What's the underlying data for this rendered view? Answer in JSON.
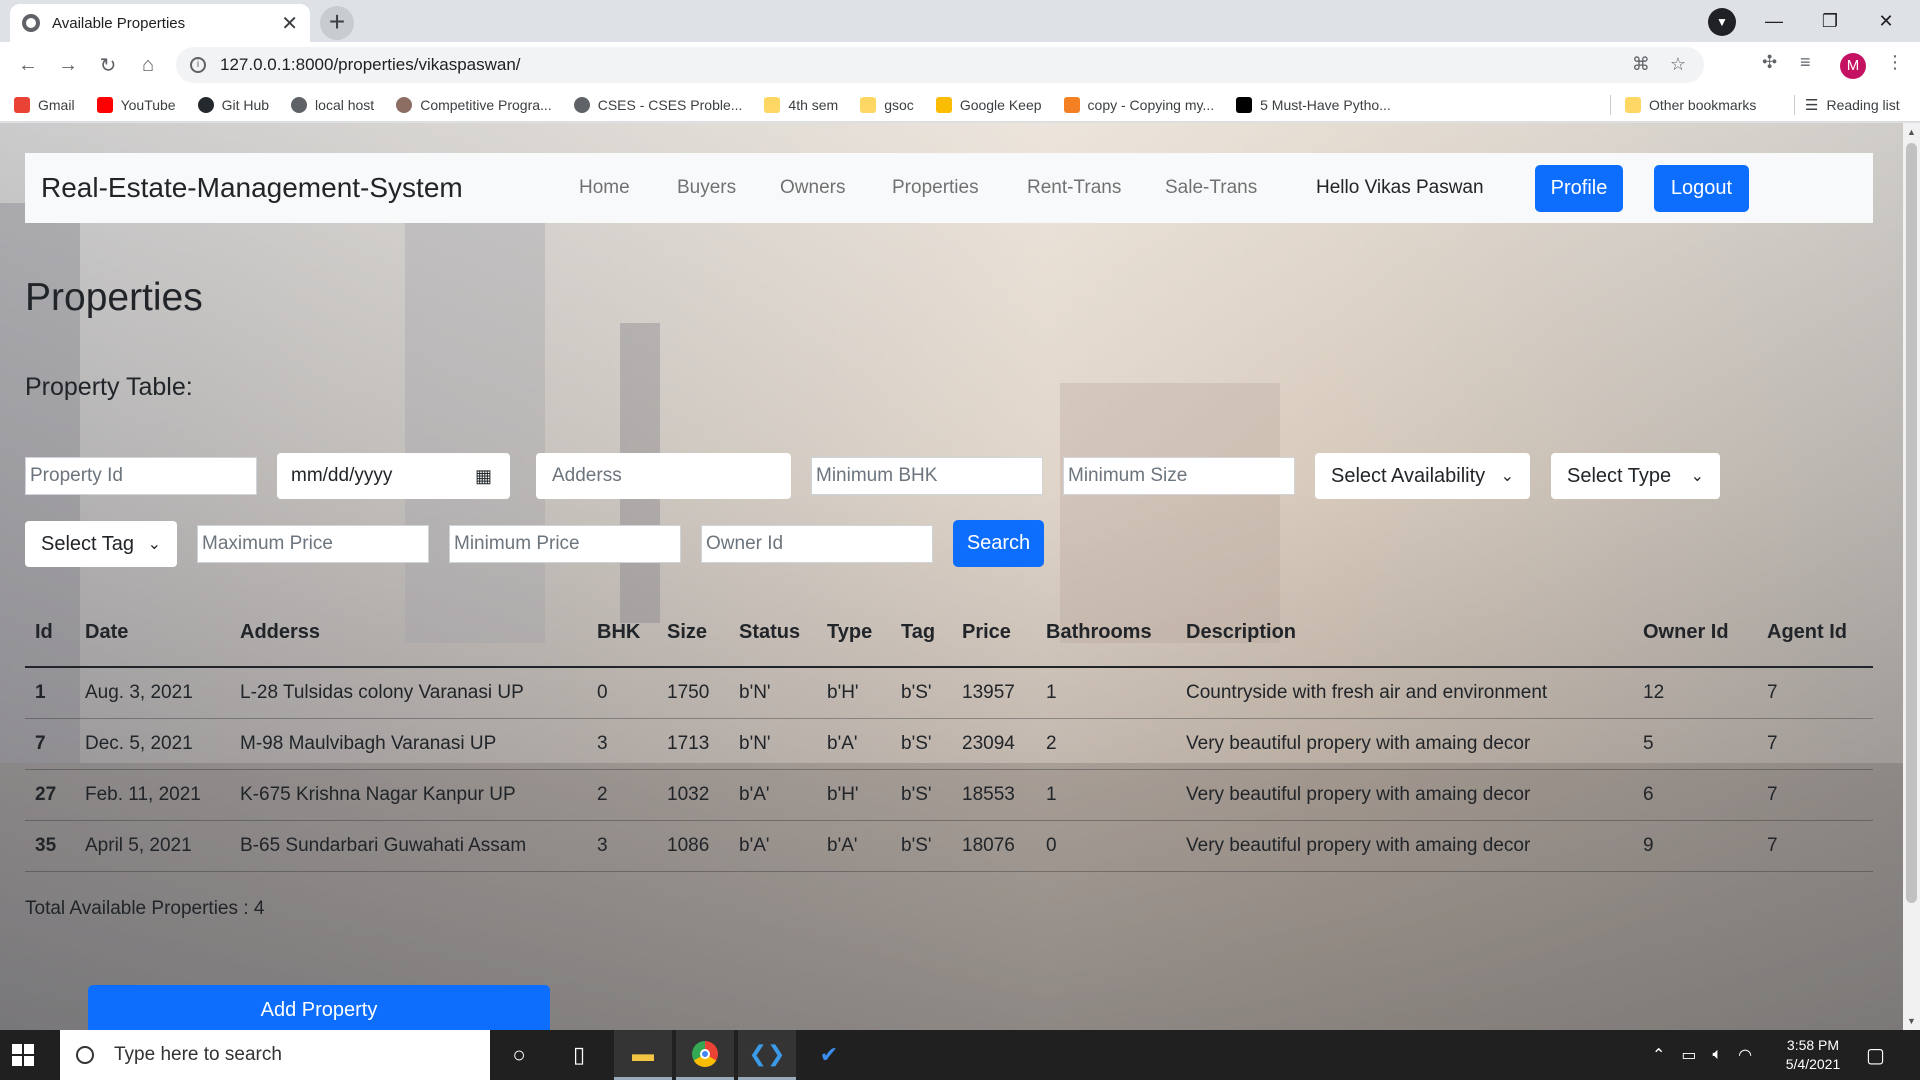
{
  "browser": {
    "tab_title": "Available Properties",
    "tab_close": "✕",
    "new_tab": "+",
    "url": "127.0.0.1:8000/properties/vikaspaswan/",
    "profile_initial": "M",
    "bookmarks": [
      {
        "label": "Gmail",
        "color": "#ea4335"
      },
      {
        "label": "YouTube",
        "color": "#ff0000"
      },
      {
        "label": "Git Hub",
        "color": "#24292e"
      },
      {
        "label": "local host",
        "color": "#5f6368"
      },
      {
        "label": "Competitive Progra...",
        "color": "#8d6e63"
      },
      {
        "label": "CSES - CSES Proble...",
        "color": "#5f6368"
      },
      {
        "label": "4th sem",
        "color": "#fdd663"
      },
      {
        "label": "gsoc",
        "color": "#fdd663"
      },
      {
        "label": "Google Keep",
        "color": "#fbbc04"
      },
      {
        "label": "copy - Copying my...",
        "color": "#f48024"
      },
      {
        "label": "5 Must-Have Pytho...",
        "color": "#000000"
      }
    ],
    "other_bookmarks": "Other bookmarks",
    "reading_list": "Reading list"
  },
  "navbar": {
    "brand": "Real-Estate-Management-System",
    "links": [
      "Home",
      "Buyers",
      "Owners",
      "Properties",
      "Rent-Trans",
      "Sale-Trans"
    ],
    "greeting": "Hello Vikas Paswan",
    "profile_btn": "Profile",
    "logout_btn": "Logout"
  },
  "page": {
    "title": "Properties",
    "subtitle": "Property Table:"
  },
  "filters": {
    "property_id_placeholder": "Property Id",
    "date_value": "mm/dd/yyyy",
    "address_placeholder": "Adderss",
    "min_bhk_placeholder": "Minimum BHK",
    "min_size_placeholder": "Minimum Size",
    "availability_select": "Select Availability",
    "type_select": "Select Type",
    "tag_select": "Select Tag",
    "max_price_placeholder": "Maximum Price",
    "min_price_placeholder": "Minimum Price",
    "owner_id_placeholder": "Owner Id",
    "search_btn": "Search"
  },
  "table": {
    "headers": [
      "Id",
      "Date",
      "Adderss",
      "BHK",
      "Size",
      "Status",
      "Type",
      "Tag",
      "Price",
      "Bathrooms",
      "Description",
      "Owner Id",
      "Agent Id"
    ],
    "rows": [
      [
        "1",
        "Aug. 3, 2021",
        "L-28 Tulsidas colony Varanasi UP",
        "0",
        "1750",
        "b'N'",
        "b'H'",
        "b'S'",
        "13957",
        "1",
        "Countryside with fresh air and environment",
        "12",
        "7"
      ],
      [
        "7",
        "Dec. 5, 2021",
        "M-98 Maulvibagh Varanasi UP",
        "3",
        "1713",
        "b'N'",
        "b'A'",
        "b'S'",
        "23094",
        "2",
        "Very beautiful propery with amaing decor",
        "5",
        "7"
      ],
      [
        "27",
        "Feb. 11, 2021",
        "K-675 Krishna Nagar Kanpur UP",
        "2",
        "1032",
        "b'A'",
        "b'H'",
        "b'S'",
        "18553",
        "1",
        "Very beautiful propery with amaing decor",
        "6",
        "7"
      ],
      [
        "35",
        "April 5, 2021",
        "B-65 Sundarbari Guwahati Assam",
        "3",
        "1086",
        "b'A'",
        "b'A'",
        "b'S'",
        "18076",
        "0",
        "Very beautiful propery with amaing decor",
        "9",
        "7"
      ]
    ]
  },
  "total_text": "Total Available Properties : 4",
  "add_property_btn": "Add Property",
  "taskbar": {
    "search_placeholder": "Type here to search",
    "time": "3:58 PM",
    "date": "5/4/2021"
  }
}
